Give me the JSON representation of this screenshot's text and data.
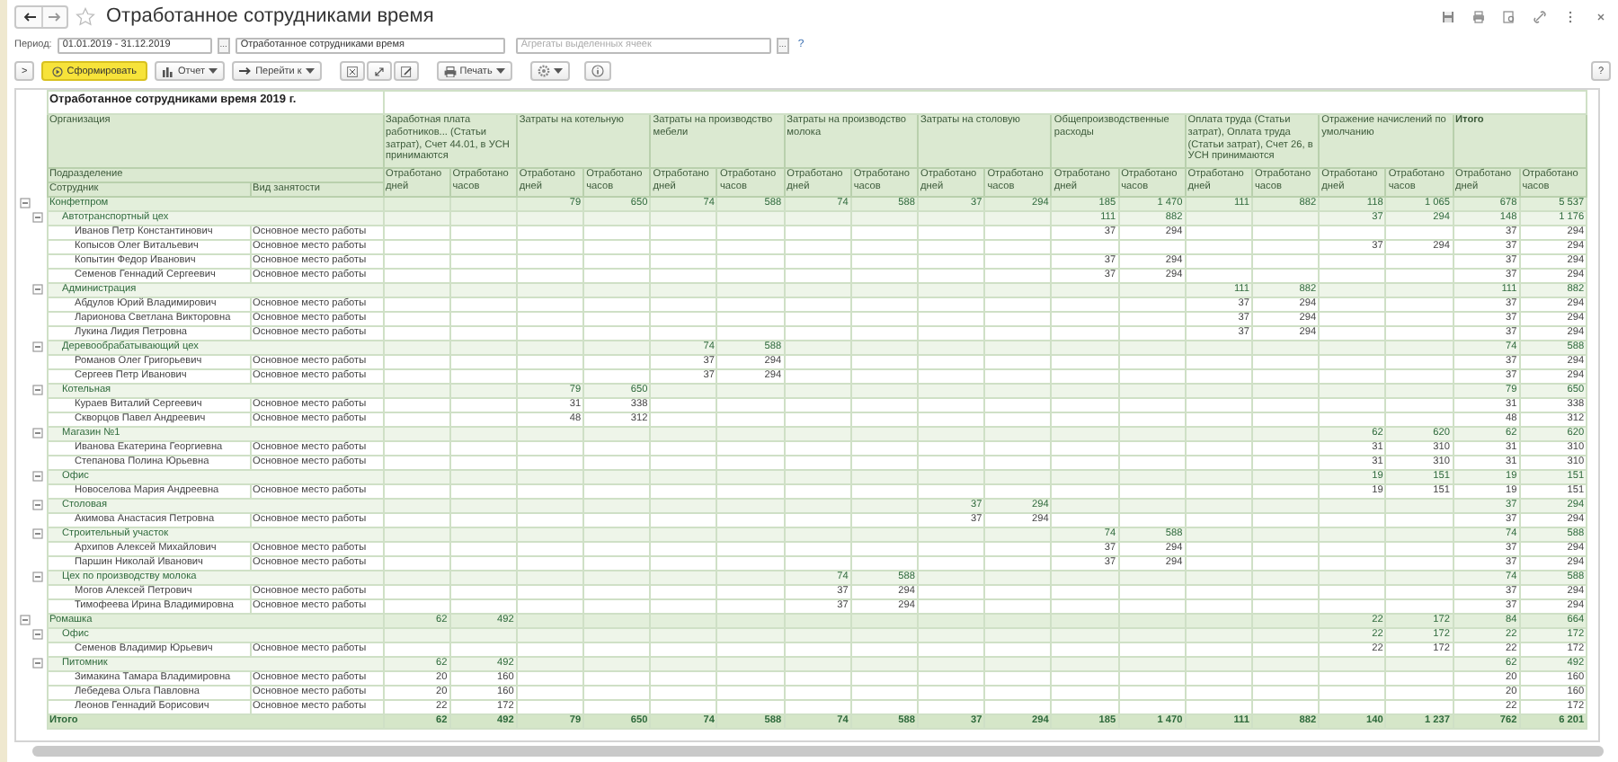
{
  "window": {
    "title": "Отработанное сотрудниками время",
    "favorite": false
  },
  "settings": {
    "period_label": "Период:",
    "period_value": "01.01.2019 - 31.12.2019",
    "period_button": "...",
    "variant_value": "Отработанное сотрудниками время",
    "aggregates_placeholder": "Агрегаты выделенных ячеек",
    "aggregates_button": "...",
    "help_link": "?"
  },
  "command_bar": {
    "panel_toggle": ">",
    "generate": "Сформировать",
    "report_menu": "Отчет",
    "goto_menu": "Перейти к",
    "print_menu": "Печать",
    "help_button": "?"
  },
  "report": {
    "title": "Отработанное сотрудниками время  2019 г.",
    "header": {
      "organization": "Организация",
      "subdivision": "Подразделение",
      "employee": "Сотрудник",
      "employment": "Вид занятости"
    },
    "column_groups": [
      {
        "title": "Заработная плата работников... (Статьи затрат), Счет 44.01, в УСН принимаются",
        "subcolumns": [
          "Отработано дней",
          "Отработано часов"
        ]
      },
      {
        "title": "Затраты на котельную",
        "subcolumns": [
          "Отработано дней",
          "Отработано часов"
        ]
      },
      {
        "title": "Затраты на производство мебели",
        "subcolumns": [
          "Отработано дней",
          "Отработано часов"
        ]
      },
      {
        "title": "Затраты на производство молока",
        "subcolumns": [
          "Отработано дней",
          "Отработано часов"
        ]
      },
      {
        "title": "Затраты на столовую",
        "subcolumns": [
          "Отработано дней",
          "Отработано часов"
        ]
      },
      {
        "title": "Общепроизводственные расходы",
        "subcolumns": [
          "Отработано дней",
          "Отработано часов"
        ]
      },
      {
        "title": "Оплата труда (Статьи затрат), Оплата труда (Статьи затрат), Счет 26, в УСН принимаются",
        "subcolumns": [
          "Отработано дней",
          "Отработано часов"
        ]
      },
      {
        "title": "Отражение начислений по умолчанию",
        "subcolumns": [
          "Отработано дней",
          "Отработано часов"
        ]
      },
      {
        "title": "Итого",
        "subcolumns": [
          "Отработано дней",
          "Отработано часов"
        ]
      }
    ],
    "rows": [
      {
        "name": "Конфетпром",
        "expanded": true,
        "values": {
          "boiler_days": "79",
          "boiler_hours": "650",
          "furniture_days": "74",
          "furniture_hours": "588",
          "milk_days": "74",
          "milk_hours": "588",
          "canteen_days": "37",
          "canteen_hours": "294",
          "overhead_days": "185",
          "overhead_hours": "1 470",
          "labor_days": "111",
          "labor_hours": "882",
          "default_days": "118",
          "default_hours": "1 065",
          "total_days": "678",
          "total_hours": "5 537"
        },
        "children": [
          {
            "name": "Автотранспортный цех",
            "expanded": true,
            "values": {
              "overhead_days": "111",
              "overhead_hours": "882",
              "default_days": "37",
              "default_hours": "294",
              "total_days": "148",
              "total_hours": "1 176"
            },
            "children": [
              {
                "name": "Иванов  Петр  Константинович",
                "employment": "Основное место работы",
                "values": {
                  "overhead_days": "37",
                  "overhead_hours": "294",
                  "total_days": "37",
                  "total_hours": "294"
                }
              },
              {
                "name": "Копысов Олег Витальевич",
                "employment": "Основное место работы",
                "values": {
                  "default_days": "37",
                  "default_hours": "294",
                  "total_days": "37",
                  "total_hours": "294"
                }
              },
              {
                "name": "Копытин Федор Иванович",
                "employment": "Основное место работы",
                "values": {
                  "overhead_days": "37",
                  "overhead_hours": "294",
                  "total_days": "37",
                  "total_hours": "294"
                }
              },
              {
                "name": "Семенов Геннадий Сергеевич",
                "employment": "Основное место работы",
                "values": {
                  "overhead_days": "37",
                  "overhead_hours": "294",
                  "total_days": "37",
                  "total_hours": "294"
                }
              }
            ]
          },
          {
            "name": "Администрация",
            "expanded": true,
            "values": {
              "labor_days": "111",
              "labor_hours": "882",
              "total_days": "111",
              "total_hours": "882"
            },
            "children": [
              {
                "name": "Абдулов Юрий Владимирович",
                "employment": "Основное место работы",
                "values": {
                  "labor_days": "37",
                  "labor_hours": "294",
                  "total_days": "37",
                  "total_hours": "294"
                }
              },
              {
                "name": "Ларионова Светлана Викторовна",
                "employment": "Основное место работы",
                "values": {
                  "labor_days": "37",
                  "labor_hours": "294",
                  "total_days": "37",
                  "total_hours": "294"
                }
              },
              {
                "name": "Лукина  Лидия Петровна",
                "employment": "Основное место работы",
                "values": {
                  "labor_days": "37",
                  "labor_hours": "294",
                  "total_days": "37",
                  "total_hours": "294"
                }
              }
            ]
          },
          {
            "name": "Деревообрабатывающий цех",
            "expanded": true,
            "values": {
              "furniture_days": "74",
              "furniture_hours": "588",
              "total_days": "74",
              "total_hours": "588"
            },
            "children": [
              {
                "name": "Романов Олег Григорьевич",
                "employment": "Основное место работы",
                "values": {
                  "furniture_days": "37",
                  "furniture_hours": "294",
                  "total_days": "37",
                  "total_hours": "294"
                }
              },
              {
                "name": "Сергеев Петр Иванович",
                "employment": "Основное место работы",
                "values": {
                  "furniture_days": "37",
                  "furniture_hours": "294",
                  "total_days": "37",
                  "total_hours": "294"
                }
              }
            ]
          },
          {
            "name": "Котельная",
            "expanded": true,
            "values": {
              "boiler_days": "79",
              "boiler_hours": "650",
              "total_days": "79",
              "total_hours": "650"
            },
            "children": [
              {
                "name": "Кураев Виталий Сергеевич",
                "employment": "Основное место работы",
                "values": {
                  "boiler_days": "31",
                  "boiler_hours": "338",
                  "total_days": "31",
                  "total_hours": "338"
                }
              },
              {
                "name": "Скворцов Павел Андреевич",
                "employment": "Основное место работы",
                "values": {
                  "boiler_days": "48",
                  "boiler_hours": "312",
                  "total_days": "48",
                  "total_hours": "312"
                }
              }
            ]
          },
          {
            "name": "Магазин №1",
            "expanded": true,
            "values": {
              "default_days": "62",
              "default_hours": "620",
              "total_days": "62",
              "total_hours": "620"
            },
            "children": [
              {
                "name": "Иванова Екатерина Георгиевна",
                "employment": "Основное место работы",
                "values": {
                  "default_days": "31",
                  "default_hours": "310",
                  "total_days": "31",
                  "total_hours": "310"
                }
              },
              {
                "name": "Степанова Полина Юрьевна",
                "employment": "Основное место работы",
                "values": {
                  "default_days": "31",
                  "default_hours": "310",
                  "total_days": "31",
                  "total_hours": "310"
                }
              }
            ]
          },
          {
            "name": "Офис",
            "expanded": true,
            "values": {
              "default_days": "19",
              "default_hours": "151",
              "total_days": "19",
              "total_hours": "151"
            },
            "children": [
              {
                "name": "Новоселова Мария Андреевна",
                "employment": "Основное место работы",
                "values": {
                  "default_days": "19",
                  "default_hours": "151",
                  "total_days": "19",
                  "total_hours": "151"
                }
              }
            ]
          },
          {
            "name": "Столовая",
            "expanded": true,
            "values": {
              "canteen_days": "37",
              "canteen_hours": "294",
              "total_days": "37",
              "total_hours": "294"
            },
            "children": [
              {
                "name": "Акимова Анастасия Петровна",
                "employment": "Основное место работы",
                "values": {
                  "canteen_days": "37",
                  "canteen_hours": "294",
                  "total_days": "37",
                  "total_hours": "294"
                }
              }
            ]
          },
          {
            "name": "Строительный участок",
            "expanded": true,
            "values": {
              "overhead_days": "74",
              "overhead_hours": "588",
              "total_days": "74",
              "total_hours": "588"
            },
            "children": [
              {
                "name": "Архипов Алексей Михайлович",
                "employment": "Основное место работы",
                "values": {
                  "overhead_days": "37",
                  "overhead_hours": "294",
                  "total_days": "37",
                  "total_hours": "294"
                }
              },
              {
                "name": "Паршин Николай Иванович",
                "employment": "Основное место работы",
                "values": {
                  "overhead_days": "37",
                  "overhead_hours": "294",
                  "total_days": "37",
                  "total_hours": "294"
                }
              }
            ]
          },
          {
            "name": "Цех по производству молока",
            "expanded": true,
            "values": {
              "milk_days": "74",
              "milk_hours": "588",
              "total_days": "74",
              "total_hours": "588"
            },
            "children": [
              {
                "name": "Могов Алексей Петрович",
                "employment": "Основное место работы",
                "values": {
                  "milk_days": "37",
                  "milk_hours": "294",
                  "total_days": "37",
                  "total_hours": "294"
                }
              },
              {
                "name": "Тимофеева Ирина Владимировна",
                "employment": "Основное место работы",
                "values": {
                  "milk_days": "37",
                  "milk_hours": "294",
                  "total_days": "37",
                  "total_hours": "294"
                }
              }
            ]
          }
        ]
      },
      {
        "name": "Ромашка",
        "expanded": true,
        "values": {
          "wage_days": "62",
          "wage_hours": "492",
          "default_days": "22",
          "default_hours": "172",
          "total_days": "84",
          "total_hours": "664"
        },
        "children": [
          {
            "name": "Офис",
            "expanded": true,
            "values": {
              "default_days": "22",
              "default_hours": "172",
              "total_days": "22",
              "total_hours": "172"
            },
            "children": [
              {
                "name": "Семенов Владимир Юрьевич",
                "employment": "Основное место работы",
                "values": {
                  "default_days": "22",
                  "default_hours": "172",
                  "total_days": "22",
                  "total_hours": "172"
                }
              }
            ]
          },
          {
            "name": "Питомник",
            "expanded": true,
            "values": {
              "wage_days": "62",
              "wage_hours": "492",
              "total_days": "62",
              "total_hours": "492"
            },
            "children": [
              {
                "name": "Зимакина Тамара Владимировна",
                "employment": "Основное место работы",
                "values": {
                  "wage_days": "20",
                  "wage_hours": "160",
                  "total_days": "20",
                  "total_hours": "160"
                }
              },
              {
                "name": "Лебедева Ольга Павловна",
                "employment": "Основное место работы",
                "values": {
                  "wage_days": "20",
                  "wage_hours": "160",
                  "total_days": "20",
                  "total_hours": "160"
                }
              },
              {
                "name": "Леонов Геннадий Борисович",
                "employment": "Основное место работы",
                "values": {
                  "wage_days": "22",
                  "wage_hours": "172",
                  "total_days": "22",
                  "total_hours": "172"
                }
              }
            ]
          }
        ]
      }
    ],
    "total": {
      "label": "Итого",
      "values": {
        "wage_days": "62",
        "wage_hours": "492",
        "boiler_days": "79",
        "boiler_hours": "650",
        "furniture_days": "74",
        "furniture_hours": "588",
        "milk_days": "74",
        "milk_hours": "588",
        "canteen_days": "37",
        "canteen_hours": "294",
        "overhead_days": "185",
        "overhead_hours": "1 470",
        "labor_days": "111",
        "labor_hours": "882",
        "default_days": "140",
        "default_hours": "1 237",
        "total_days": "762",
        "total_hours": "6 201"
      }
    }
  }
}
